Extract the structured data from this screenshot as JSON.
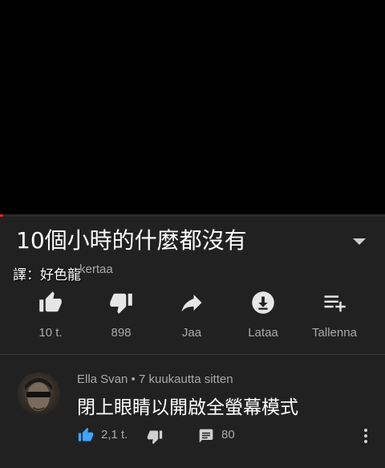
{
  "video": {
    "title": "10個小時的什麼都沒有",
    "views_partial": "kertaa",
    "credit": "譯：好色龍",
    "progress_fraction": 0.01
  },
  "actions": [
    {
      "icon": "thumbs-up-icon",
      "label": "10 t."
    },
    {
      "icon": "thumbs-down-icon",
      "label": "898"
    },
    {
      "icon": "share-icon",
      "label": "Jaa"
    },
    {
      "icon": "download-icon",
      "label": "Lataa"
    },
    {
      "icon": "add-to-playlist-icon",
      "label": "Tallenna"
    }
  ],
  "comment": {
    "author": "Ella Svan",
    "separator": "•",
    "time": "7 kuukautta sitten",
    "text": "閉上眼睛以開啟全螢幕模式",
    "likes": "2,1 t.",
    "replies": "80"
  },
  "colors": {
    "panel": "#212121",
    "secondary_text": "#aaaaaa",
    "accent_blue": "#3ea6ff",
    "progress": "#e02424"
  }
}
